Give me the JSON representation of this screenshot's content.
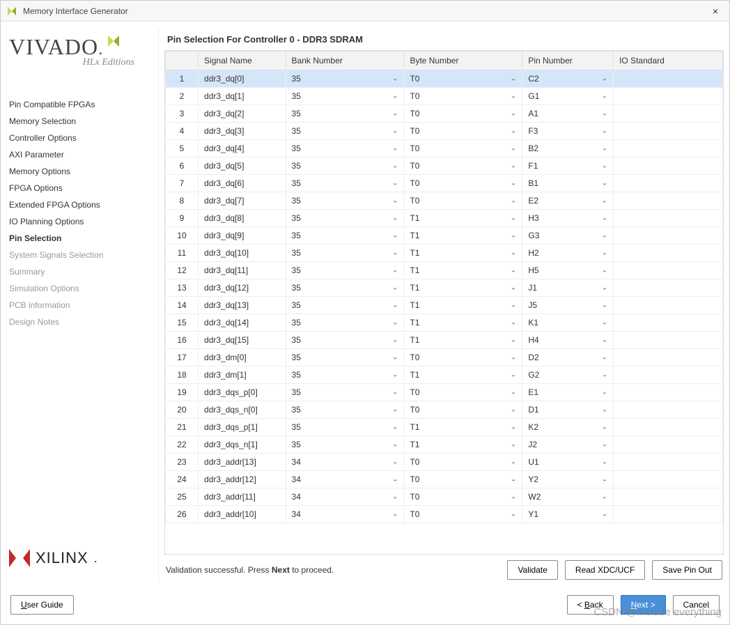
{
  "window": {
    "title": "Memory Interface Generator",
    "close_label": "×"
  },
  "sidebar": {
    "logo_main": "VIVADO",
    "logo_sub": "HLx Editions",
    "items": [
      {
        "label": "Pin Compatible FPGAs",
        "state": "normal"
      },
      {
        "label": "Memory Selection",
        "state": "normal"
      },
      {
        "label": "Controller Options",
        "state": "normal"
      },
      {
        "label": "AXI Parameter",
        "state": "normal"
      },
      {
        "label": "Memory Options",
        "state": "normal"
      },
      {
        "label": "FPGA Options",
        "state": "normal"
      },
      {
        "label": "Extended FPGA Options",
        "state": "normal"
      },
      {
        "label": "IO Planning Options",
        "state": "normal"
      },
      {
        "label": "Pin Selection",
        "state": "active"
      },
      {
        "label": "System Signals Selection",
        "state": "disabled"
      },
      {
        "label": "Summary",
        "state": "disabled"
      },
      {
        "label": "Simulation Options",
        "state": "disabled"
      },
      {
        "label": "PCB information",
        "state": "disabled"
      },
      {
        "label": "Design Notes",
        "state": "disabled"
      }
    ],
    "xilinx_label": "XILINX"
  },
  "main": {
    "title": "Pin Selection For Controller 0 - DDR3 SDRAM",
    "columns": [
      "",
      "Signal Name",
      "Bank Number",
      "Byte Number",
      "Pin Number",
      "IO Standard"
    ],
    "rows": [
      {
        "idx": "1",
        "signal": "ddr3_dq[0]",
        "bank": "35",
        "byte": "T0",
        "pin": "C2",
        "io": ""
      },
      {
        "idx": "2",
        "signal": "ddr3_dq[1]",
        "bank": "35",
        "byte": "T0",
        "pin": "G1",
        "io": ""
      },
      {
        "idx": "3",
        "signal": "ddr3_dq[2]",
        "bank": "35",
        "byte": "T0",
        "pin": "A1",
        "io": ""
      },
      {
        "idx": "4",
        "signal": "ddr3_dq[3]",
        "bank": "35",
        "byte": "T0",
        "pin": "F3",
        "io": ""
      },
      {
        "idx": "5",
        "signal": "ddr3_dq[4]",
        "bank": "35",
        "byte": "T0",
        "pin": "B2",
        "io": ""
      },
      {
        "idx": "6",
        "signal": "ddr3_dq[5]",
        "bank": "35",
        "byte": "T0",
        "pin": "F1",
        "io": ""
      },
      {
        "idx": "7",
        "signal": "ddr3_dq[6]",
        "bank": "35",
        "byte": "T0",
        "pin": "B1",
        "io": ""
      },
      {
        "idx": "8",
        "signal": "ddr3_dq[7]",
        "bank": "35",
        "byte": "T0",
        "pin": "E2",
        "io": ""
      },
      {
        "idx": "9",
        "signal": "ddr3_dq[8]",
        "bank": "35",
        "byte": "T1",
        "pin": "H3",
        "io": ""
      },
      {
        "idx": "10",
        "signal": "ddr3_dq[9]",
        "bank": "35",
        "byte": "T1",
        "pin": "G3",
        "io": ""
      },
      {
        "idx": "11",
        "signal": "ddr3_dq[10]",
        "bank": "35",
        "byte": "T1",
        "pin": "H2",
        "io": ""
      },
      {
        "idx": "12",
        "signal": "ddr3_dq[11]",
        "bank": "35",
        "byte": "T1",
        "pin": "H5",
        "io": ""
      },
      {
        "idx": "13",
        "signal": "ddr3_dq[12]",
        "bank": "35",
        "byte": "T1",
        "pin": "J1",
        "io": ""
      },
      {
        "idx": "14",
        "signal": "ddr3_dq[13]",
        "bank": "35",
        "byte": "T1",
        "pin": "J5",
        "io": ""
      },
      {
        "idx": "15",
        "signal": "ddr3_dq[14]",
        "bank": "35",
        "byte": "T1",
        "pin": "K1",
        "io": ""
      },
      {
        "idx": "16",
        "signal": "ddr3_dq[15]",
        "bank": "35",
        "byte": "T1",
        "pin": "H4",
        "io": ""
      },
      {
        "idx": "17",
        "signal": "ddr3_dm[0]",
        "bank": "35",
        "byte": "T0",
        "pin": "D2",
        "io": ""
      },
      {
        "idx": "18",
        "signal": "ddr3_dm[1]",
        "bank": "35",
        "byte": "T1",
        "pin": "G2",
        "io": ""
      },
      {
        "idx": "19",
        "signal": "ddr3_dqs_p[0]",
        "bank": "35",
        "byte": "T0",
        "pin": "E1",
        "io": ""
      },
      {
        "idx": "20",
        "signal": "ddr3_dqs_n[0]",
        "bank": "35",
        "byte": "T0",
        "pin": "D1",
        "io": ""
      },
      {
        "idx": "21",
        "signal": "ddr3_dqs_p[1]",
        "bank": "35",
        "byte": "T1",
        "pin": "K2",
        "io": ""
      },
      {
        "idx": "22",
        "signal": "ddr3_dqs_n[1]",
        "bank": "35",
        "byte": "T1",
        "pin": "J2",
        "io": ""
      },
      {
        "idx": "23",
        "signal": "ddr3_addr[13]",
        "bank": "34",
        "byte": "T0",
        "pin": "U1",
        "io": ""
      },
      {
        "idx": "24",
        "signal": "ddr3_addr[12]",
        "bank": "34",
        "byte": "T0",
        "pin": "Y2",
        "io": ""
      },
      {
        "idx": "25",
        "signal": "ddr3_addr[11]",
        "bank": "34",
        "byte": "T0",
        "pin": "W2",
        "io": ""
      },
      {
        "idx": "26",
        "signal": "ddr3_addr[10]",
        "bank": "34",
        "byte": "T0",
        "pin": "Y1",
        "io": ""
      }
    ],
    "selected_row_index": 0,
    "status_prefix": "Validation successful. Press ",
    "status_bold": "Next",
    "status_suffix": " to proceed.",
    "buttons": {
      "validate": "Validate",
      "read_xdc": "Read XDC/UCF",
      "save_pinout": "Save Pin Out"
    }
  },
  "footer": {
    "user_guide": "User Guide",
    "user_guide_accel": "U",
    "back": "< Back",
    "back_accel": "B",
    "next": "Next >",
    "next_accel": "N",
    "cancel": "Cancel"
  },
  "watermark": "CSDN @Include everything"
}
